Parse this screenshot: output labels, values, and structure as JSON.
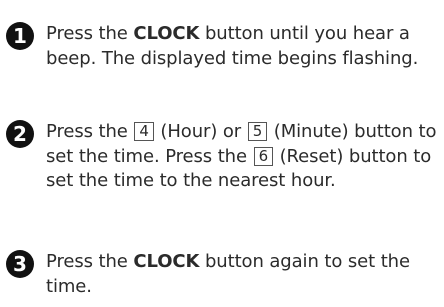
{
  "steps": [
    {
      "number": "1",
      "pre": "Press the ",
      "button": "CLOCK",
      "post": " button until you hear a beep. The displayed time begins flashing."
    },
    {
      "number": "2",
      "t1": "Press the ",
      "key1": "4",
      "t2": " (Hour) or ",
      "key2": "5",
      "t3": " (Minute) button to set the time. Press the ",
      "key3": "6",
      "t4": " (Reset) button to set the time to the nearest hour."
    },
    {
      "number": "3",
      "pre": "Press the ",
      "button": "CLOCK",
      "post": " button again to set the time."
    }
  ]
}
